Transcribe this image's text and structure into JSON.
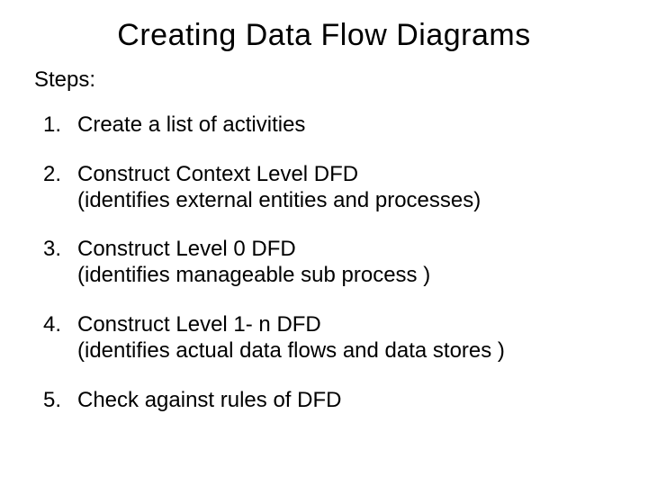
{
  "title": "Creating Data Flow Diagrams",
  "subtitle": "Steps:",
  "steps": [
    {
      "num": "1.",
      "text": "Create a list of activities",
      "desc": ""
    },
    {
      "num": "2.",
      "text": "Construct Context Level DFD",
      "desc": "(identifies external entities and processes)"
    },
    {
      "num": "3.",
      "text": "Construct Level 0 DFD",
      "desc": "(identifies manageable sub process )"
    },
    {
      "num": "4.",
      "text": "Construct Level 1- n DFD",
      "desc": "(identifies actual data flows and data stores )"
    },
    {
      "num": "5.",
      "text": "Check against rules of DFD",
      "desc": ""
    }
  ]
}
